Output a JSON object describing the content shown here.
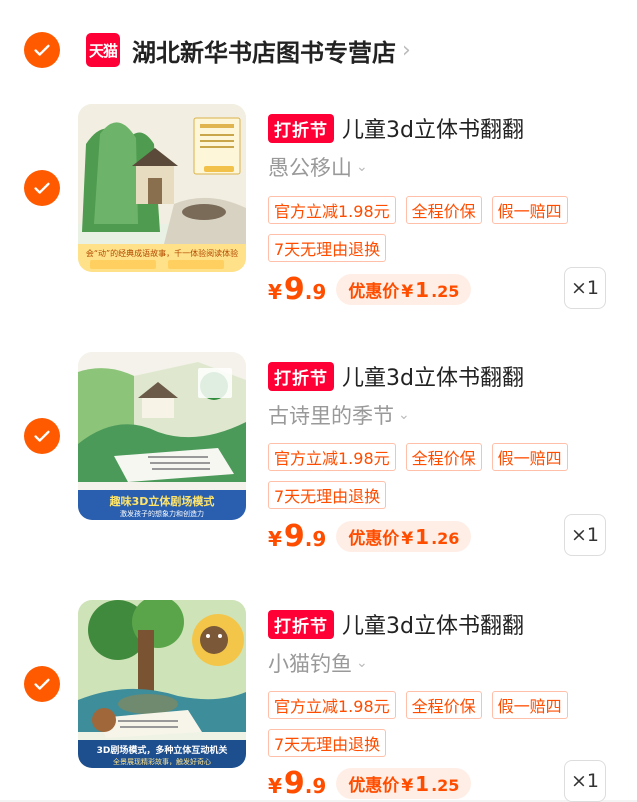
{
  "colors": {
    "accent": "#ff5a00",
    "tmall_red": "#ff0036",
    "price_orange": "#ff4d00"
  },
  "store": {
    "badge": "天猫",
    "name": "湖北新华书店图书专营店"
  },
  "items": [
    {
      "promo_tag": "打折节",
      "title": "儿童3d立体书翻翻",
      "variant": "愚公移山",
      "tags": [
        "官方立减1.98元",
        "全程价保",
        "假一赔四",
        "7天无理由退换"
      ],
      "price_symbol": "¥",
      "price_int": "9",
      "price_dec": ".9",
      "discount_label": "优惠价",
      "discount_symbol": "¥",
      "discount_int": "1",
      "discount_dec": ".25",
      "quantity": "×1",
      "image_caption": "会“动”的经典成语故事，千一体验阅读体验"
    },
    {
      "promo_tag": "打折节",
      "title": "儿童3d立体书翻翻",
      "variant": "古诗里的季节",
      "tags": [
        "官方立减1.98元",
        "全程价保",
        "假一赔四",
        "7天无理由退换"
      ],
      "price_symbol": "¥",
      "price_int": "9",
      "price_dec": ".9",
      "discount_label": "优惠价",
      "discount_symbol": "¥",
      "discount_int": "1",
      "discount_dec": ".26",
      "quantity": "×1",
      "image_caption": "趣味3D立体剧场模式",
      "image_subcaption": "激发孩子的想象力和创造力"
    },
    {
      "promo_tag": "打折节",
      "title": "儿童3d立体书翻翻",
      "variant": "小猫钓鱼",
      "tags": [
        "官方立减1.98元",
        "全程价保",
        "假一赔四",
        "7天无理由退换"
      ],
      "price_symbol": "¥",
      "price_int": "9",
      "price_dec": ".9",
      "discount_label": "优惠价",
      "discount_symbol": "¥",
      "discount_int": "1",
      "discount_dec": ".25",
      "quantity": "×1",
      "image_caption": "3D剧场模式，多种立体互动机关",
      "image_subcaption": "全景展现精彩故事，触发好奇心"
    }
  ]
}
